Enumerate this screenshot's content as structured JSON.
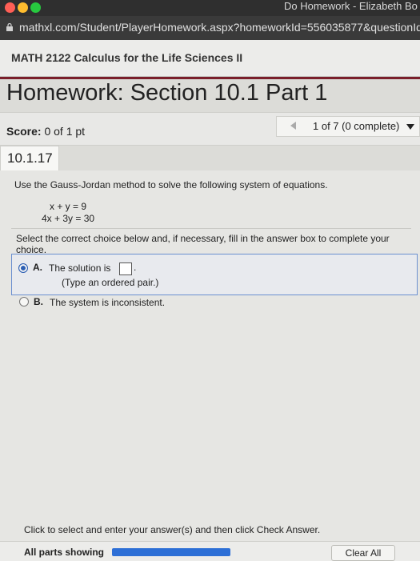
{
  "browser": {
    "window_title": "Do Homework - Elizabeth Bo",
    "url": "mathxl.com/Student/PlayerHomework.aspx?homeworkId=556035877&questionId",
    "traffic_light_colors": [
      "#ff5f56",
      "#ffbd2e",
      "#27c93f"
    ],
    "lock_icon": "lock-icon"
  },
  "course": {
    "title": "MATH 2122 Calculus for the Life Sciences II"
  },
  "homework": {
    "title": "Homework: Section 10.1 Part 1"
  },
  "score": {
    "label": "Score:",
    "value": "0 of 1 pt"
  },
  "question_nav": {
    "label": "1 of 7 (0 complete)",
    "prev_icon": "triangle-left-icon",
    "menu_icon": "caret-down-icon"
  },
  "question": {
    "number": "10.1.17",
    "instructions": "Use the Gauss-Jordan method to solve the following system of equations.",
    "equations": [
      "x + y = 9",
      "4x + 3y = 30"
    ],
    "select_prompt": "Select the correct choice below and, if necessary, fill in the answer box to complete your choice.",
    "choices": [
      {
        "letter": "A.",
        "text": "The solution is",
        "suffix": ".",
        "hint": "(Type an ordered pair.)",
        "selected": true
      },
      {
        "letter": "B.",
        "text": "The system is inconsistent.",
        "selected": false
      }
    ],
    "answer_value": ""
  },
  "footer": {
    "instruction": "Click to select and enter your answer(s) and then click Check Answer.",
    "parts_label": "All parts showing",
    "progress": 1.0,
    "clear_label": "Clear All"
  },
  "colors": {
    "accent_rule": "#7a1f2b",
    "selected_radio": "#2d5fb3",
    "progress_bar": "#2d6fd6"
  }
}
